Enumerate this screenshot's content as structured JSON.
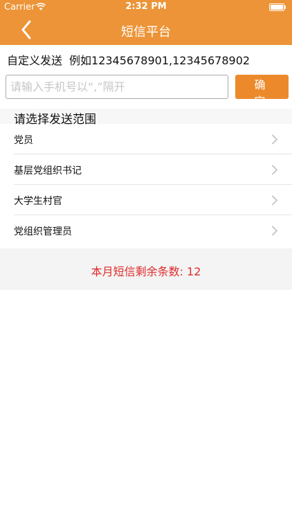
{
  "status_bar": {
    "carrier": "Carrier",
    "time": "2:32 PM"
  },
  "nav": {
    "title": "短信平台",
    "back_icon": "chevron-left-icon"
  },
  "custom_send": {
    "label": "自定义发送",
    "example": "例如12345678901,12345678902"
  },
  "phone_input": {
    "value": "",
    "placeholder": "请输入手机号以“,”隔开"
  },
  "confirm_button": {
    "label": "确定"
  },
  "scope_section": {
    "title": "请选择发送范围",
    "items": [
      {
        "label": "党员"
      },
      {
        "label": "基层党组织书记"
      },
      {
        "label": "大学生村官"
      },
      {
        "label": "党组织管理员"
      }
    ]
  },
  "quota": {
    "text": "本月短信剩余条数: 12"
  },
  "colors": {
    "accent": "#ec9437",
    "button": "#ec8a2b",
    "quota_text": "#e02a2a"
  }
}
